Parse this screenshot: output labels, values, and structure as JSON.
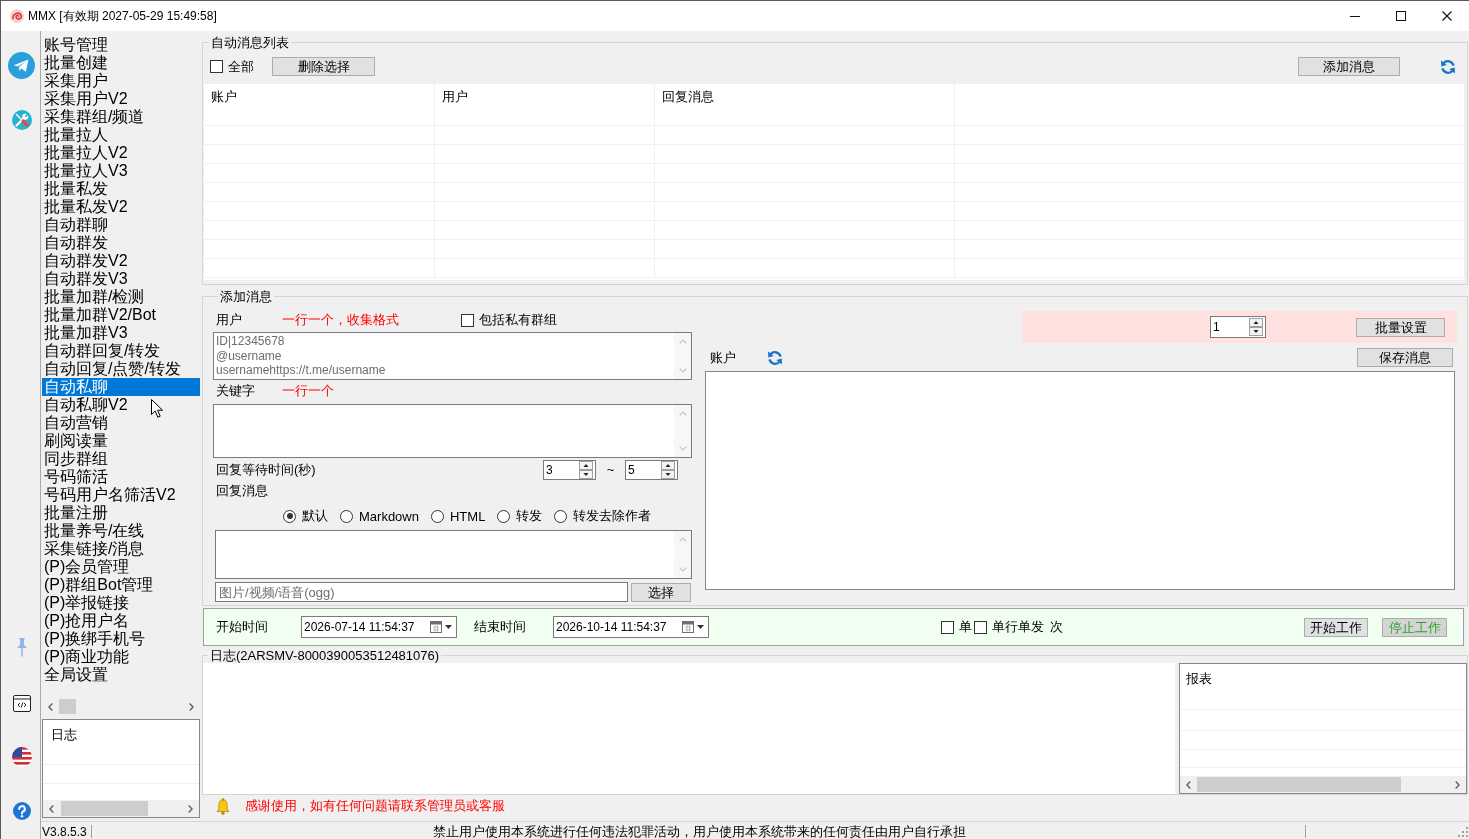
{
  "window": {
    "title": "MMX [有效期 2027-05-29 15:49:58]"
  },
  "sidebar": {
    "items": [
      {
        "label": "账号管理",
        "selected": false
      },
      {
        "label": "批量创建",
        "selected": false
      },
      {
        "label": "采集用户",
        "selected": false
      },
      {
        "label": "采集用户V2",
        "selected": false
      },
      {
        "label": "采集群组/频道",
        "selected": false
      },
      {
        "label": "批量拉人",
        "selected": false
      },
      {
        "label": "批量拉人V2",
        "selected": false
      },
      {
        "label": "批量拉人V3",
        "selected": false
      },
      {
        "label": "批量私发",
        "selected": false
      },
      {
        "label": "批量私发V2",
        "selected": false
      },
      {
        "label": "自动群聊",
        "selected": false
      },
      {
        "label": "自动群发",
        "selected": false
      },
      {
        "label": "自动群发V2",
        "selected": false
      },
      {
        "label": "自动群发V3",
        "selected": false
      },
      {
        "label": "批量加群/检测",
        "selected": false
      },
      {
        "label": "批量加群V2/Bot",
        "selected": false
      },
      {
        "label": "批量加群V3",
        "selected": false
      },
      {
        "label": "自动群回复/转发",
        "selected": false
      },
      {
        "label": "自动回复/点赞/转发",
        "selected": false
      },
      {
        "label": "自动私聊",
        "selected": true
      },
      {
        "label": "自动私聊V2",
        "selected": false
      },
      {
        "label": "自动营销",
        "selected": false
      },
      {
        "label": "刷阅读量",
        "selected": false
      },
      {
        "label": "同步群组",
        "selected": false
      },
      {
        "label": "号码筛活",
        "selected": false
      },
      {
        "label": "号码用户名筛活V2",
        "selected": false
      },
      {
        "label": "批量注册",
        "selected": false
      },
      {
        "label": "批量养号/在线",
        "selected": false
      },
      {
        "label": "采集链接/消息",
        "selected": false
      },
      {
        "label": "(P)会员管理",
        "selected": false
      },
      {
        "label": "(P)群组Bot管理",
        "selected": false
      },
      {
        "label": "(P)举报链接",
        "selected": false
      },
      {
        "label": "(P)抢用户名",
        "selected": false
      },
      {
        "label": "(P)换绑手机号",
        "selected": false
      },
      {
        "label": "(P)商业功能",
        "selected": false
      },
      {
        "label": "全局设置",
        "selected": false
      }
    ]
  },
  "sidebar_log": {
    "column_header": "日志"
  },
  "auto_message_list": {
    "title": "自动消息列表",
    "select_all": {
      "label": "全部",
      "checked": false
    },
    "delete_button": "删除选择",
    "add_button": "添加消息",
    "table": {
      "columns": [
        "账户",
        "用户",
        "回复消息"
      ]
    }
  },
  "add_message": {
    "title": "添加消息",
    "users": {
      "label": "用户",
      "hint": "一行一个，收集格式",
      "placeholder": "ID|12345678\n@username\nusernamehttps://t.me/username"
    },
    "include_private": {
      "label": "包括私有群组",
      "checked": false
    },
    "keywords": {
      "label": "关键字",
      "hint": "一行一个"
    },
    "wait_time": {
      "label": "回复等待时间(秒)",
      "min": "3",
      "separator": "~",
      "max": "5"
    },
    "reply": {
      "label": "回复消息",
      "formats": [
        {
          "label": "默认",
          "selected": true
        },
        {
          "label": "Markdown",
          "selected": false
        },
        {
          "label": "HTML",
          "selected": false
        },
        {
          "label": "转发",
          "selected": false
        },
        {
          "label": "转发去除作者",
          "selected": false
        }
      ]
    },
    "media": {
      "placeholder": "图片/视频/语音(ogg)",
      "button": "选择"
    },
    "batch": {
      "count": "1",
      "button": "批量设置"
    },
    "accounts": {
      "label": "账户",
      "save_button": "保存消息"
    }
  },
  "schedule": {
    "start_label": "开始时间",
    "start": "2026-07-14 11:54:37",
    "end_label": "结束时间",
    "end": "2026-10-14 11:54:37",
    "options": [
      {
        "label": "单",
        "checked": false
      },
      {
        "label": "单行单发",
        "checked": false
      }
    ],
    "unit": "次",
    "buttons": [
      {
        "label": "开始工作",
        "kind": "start"
      },
      {
        "label": "停止工作",
        "kind": "stop"
      }
    ]
  },
  "log": {
    "title": "日志(2ARSMV-8000390053512481076)",
    "report_header": "报表"
  },
  "notice": "感谢使用，如有任何问题请联系管理员或客服",
  "status_bar": {
    "version": "V3.8.5.3",
    "message": "禁止用户使用本系统进行任何违法犯罪活动，用户使用本系统带来的任何责任由用户自行承担"
  }
}
